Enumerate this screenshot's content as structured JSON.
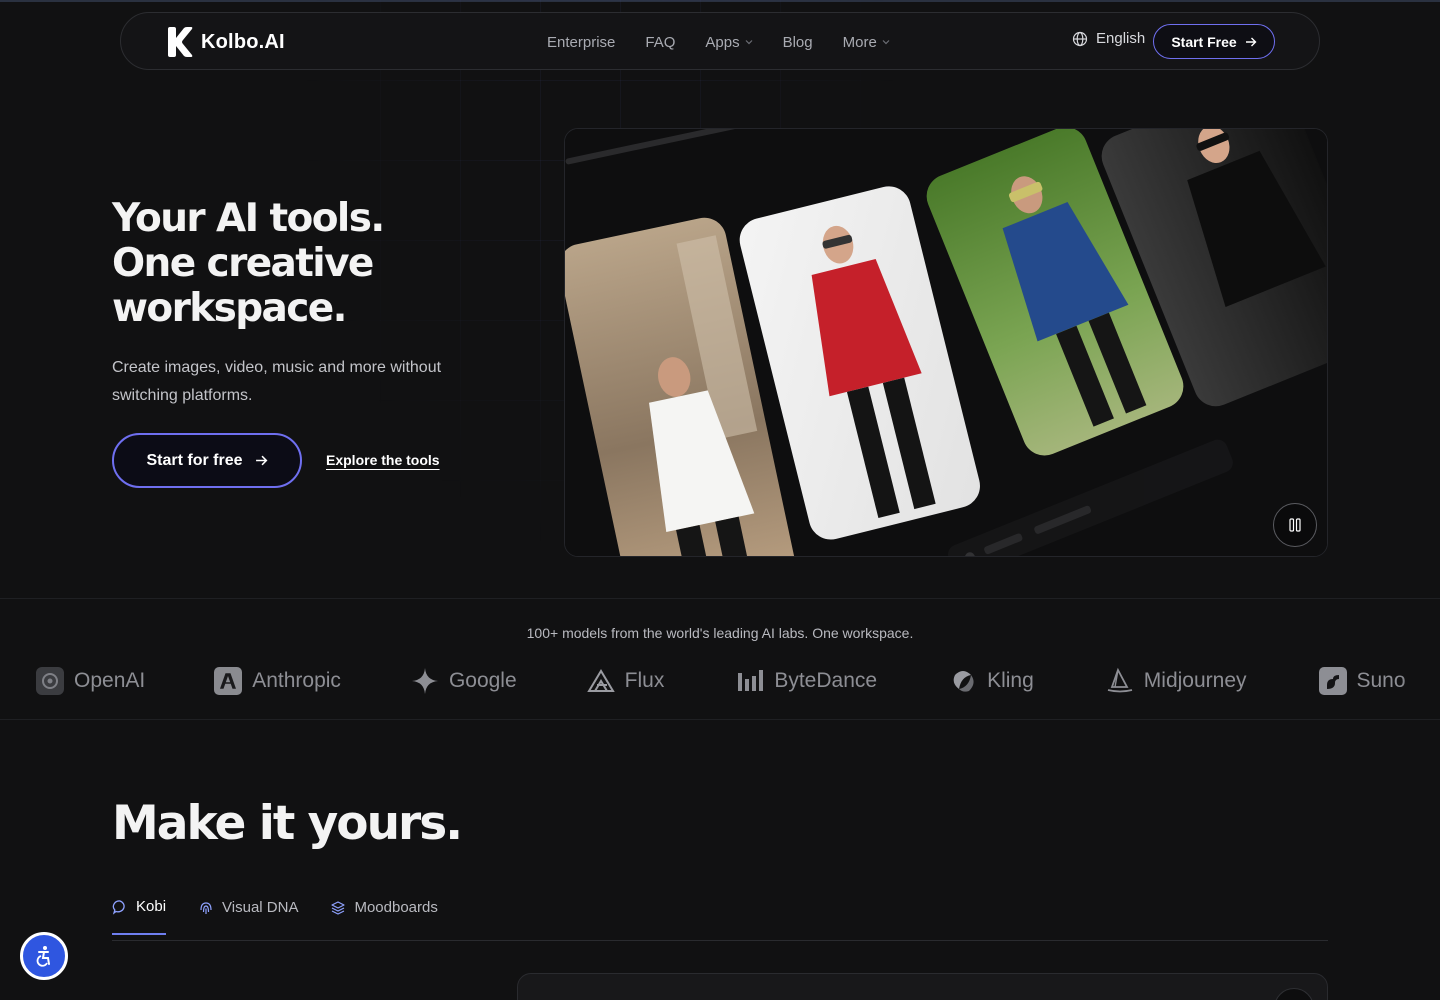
{
  "nav": {
    "brand": "Kolbo.AI",
    "items": [
      {
        "label": "Enterprise",
        "dropdown": false
      },
      {
        "label": "FAQ",
        "dropdown": false
      },
      {
        "label": "Apps",
        "dropdown": true
      },
      {
        "label": "Blog",
        "dropdown": false
      },
      {
        "label": "More",
        "dropdown": true
      }
    ],
    "language": "English",
    "cta": "Start Free"
  },
  "hero": {
    "title_lines": [
      "Your AI tools.",
      "One creative",
      "workspace."
    ],
    "subtitle": "Create images, video, music and more without switching platforms.",
    "primary_cta": "Start for free",
    "secondary_cta": "Explore the tools",
    "media": {
      "description_icon": "fashion-jacket-variations",
      "control": "pause-icon"
    }
  },
  "labs": {
    "caption": "100+ models from the world's leading AI labs. One workspace.",
    "items": [
      {
        "name": "OpenAI",
        "icon": "openai-icon"
      },
      {
        "name": "Anthropic",
        "icon": "anthropic-icon"
      },
      {
        "name": "Google",
        "icon": "google-sparkle-icon"
      },
      {
        "name": "Flux",
        "icon": "flux-icon"
      },
      {
        "name": "ByteDance",
        "icon": "bytedance-icon"
      },
      {
        "name": "Kling",
        "icon": "kling-icon"
      },
      {
        "name": "Midjourney",
        "icon": "midjourney-icon"
      },
      {
        "name": "Suno",
        "icon": "suno-icon"
      }
    ]
  },
  "make": {
    "title": "Make it yours.",
    "tabs": [
      {
        "label": "Kobi",
        "icon": "chat-bubble-icon",
        "active": true
      },
      {
        "label": "Visual DNA",
        "icon": "fingerprint-icon",
        "active": false
      },
      {
        "label": "Moodboards",
        "icon": "layers-icon",
        "active": false
      }
    ]
  },
  "accessibility": {
    "icon": "accessibility-icon"
  },
  "colors": {
    "accent": "#6f6ff0",
    "background": "#111112",
    "a11y": "#2f56e0"
  }
}
